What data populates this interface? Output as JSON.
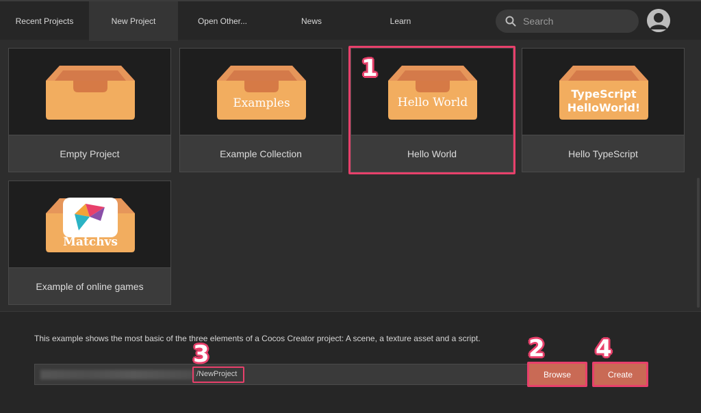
{
  "tabs": [
    {
      "label": "Recent Projects"
    },
    {
      "label": "New Project"
    },
    {
      "label": "Open Other..."
    },
    {
      "label": "News"
    },
    {
      "label": "Learn"
    }
  ],
  "search": {
    "placeholder": "Search"
  },
  "templates": [
    {
      "name": "Empty Project",
      "box_text": ""
    },
    {
      "name": "Example Collection",
      "box_text": "Examples"
    },
    {
      "name": "Hello World",
      "box_text": "Hello World"
    },
    {
      "name": "Hello TypeScript",
      "box_text_line1": "TypeScript",
      "box_text_line2": "HelloWorld!"
    },
    {
      "name": "Example of online games",
      "box_text": "Matchvs"
    }
  ],
  "description": "This example shows the most basic of the three elements of a Cocos Creator project: A scene, a texture asset and a script.",
  "path": {
    "suffix": "/NewProject"
  },
  "buttons": {
    "browse": "Browse",
    "create": "Create"
  },
  "annotations": [
    "1",
    "2",
    "3",
    "4"
  ],
  "colors": {
    "highlight": "#e8406b",
    "button": "#c96a55",
    "box": "#f2ad5f",
    "box_dark": "#d5774a"
  }
}
